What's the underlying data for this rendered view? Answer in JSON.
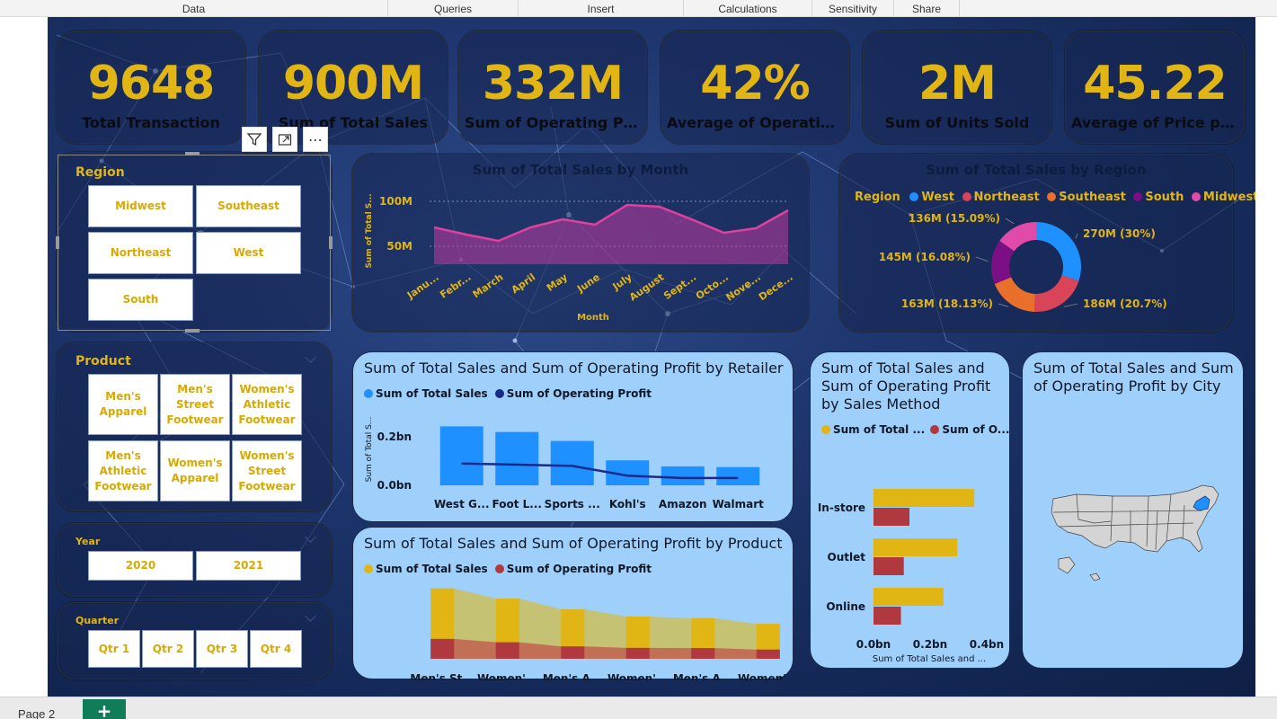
{
  "ribbon": {
    "tabs": [
      "Data",
      "Queries",
      "Insert",
      "Calculations",
      "Sensitivity",
      "Share"
    ]
  },
  "kpis": [
    {
      "value": "9648",
      "label": "Total Transaction"
    },
    {
      "value": "900M",
      "label": "Sum of Total Sales"
    },
    {
      "value": "332M",
      "label": "Sum of Operating Pr..."
    },
    {
      "value": "42%",
      "label": "Average of Operating..."
    },
    {
      "value": "2M",
      "label": "Sum of Units Sold"
    },
    {
      "value": "45.22",
      "label": "Average of Price per..."
    }
  ],
  "slicers": {
    "region": {
      "title": "Region",
      "options": [
        "Midwest",
        "Southeast",
        "Northeast",
        "West",
        "South"
      ]
    },
    "product": {
      "title": "Product",
      "options": [
        "Men's Apparel",
        "Men's Street Footwear",
        "Women's Athletic Footwear",
        "Men's Athletic Footwear",
        "Women's Apparel",
        "Women's Street Footwear"
      ]
    },
    "year": {
      "title": "Year",
      "options": [
        "2020",
        "2021"
      ]
    },
    "quarter": {
      "title": "Quarter",
      "options": [
        "Qtr 1",
        "Qtr 2",
        "Qtr 3",
        "Qtr 4"
      ]
    }
  },
  "colors": {
    "accent_yellow": "#e1b514",
    "card_light": "#9fd0fb",
    "bar_blue": "#1e90ff",
    "line_navy": "#1a2a8a",
    "area_magenta": "#e040a0",
    "bar_red": "#b0393f",
    "pie_west": "#1e90ff",
    "pie_northeast": "#d94458",
    "pie_southeast": "#e8702a",
    "pie_south": "#7a0f86",
    "pie_midwest": "#e04aa8",
    "map_highlight": "#1e90ff",
    "add_page": "#117d58"
  },
  "icons": {
    "filter": "filter-icon",
    "focus": "focus-mode-icon",
    "more": "more-options-icon"
  },
  "page": {
    "tab_label": "Page 2",
    "add_label": "+"
  },
  "chart_data": [
    {
      "type": "area",
      "title": "Sum of Total Sales by Month",
      "xlabel": "Month",
      "ylabel": "Sum of Total S...",
      "categories": [
        "Janu...",
        "Febr...",
        "March",
        "April",
        "May",
        "June",
        "July",
        "August",
        "Sept...",
        "Octo...",
        "Nove...",
        "Dece..."
      ],
      "values": [
        71,
        63,
        56,
        71,
        80,
        74,
        96,
        94,
        80,
        65,
        70,
        90
      ],
      "y_units": "M",
      "yticks": [
        "100M",
        "50M"
      ],
      "ylim": [
        30,
        110
      ]
    },
    {
      "type": "pie",
      "title": "Sum of Total Sales by Region",
      "legend_title": "Region",
      "slices": [
        {
          "name": "West",
          "value": 270,
          "label": "270M (30%)"
        },
        {
          "name": "Northeast",
          "value": 186,
          "label": "186M (20.7%)"
        },
        {
          "name": "Southeast",
          "value": 163,
          "label": "163M (18.13%)"
        },
        {
          "name": "South",
          "value": 145,
          "label": "145M (16.08%)"
        },
        {
          "name": "Midwest",
          "value": 136,
          "label": "136M (15.09%)"
        }
      ]
    },
    {
      "type": "bar",
      "title": "Sum of Total Sales and Sum of Operating Profit by Retailer",
      "ylabel": "Sum of Total S...",
      "categories": [
        "West G...",
        "Foot L...",
        "Sports ...",
        "Kohl's",
        "Amazon",
        "Walmart"
      ],
      "series": [
        {
          "name": "Sum of Total Sales",
          "values": [
            0.243,
            0.22,
            0.183,
            0.103,
            0.078,
            0.075
          ]
        },
        {
          "name": "Sum of Operating Profit",
          "values": [
            0.09,
            0.085,
            0.08,
            0.04,
            0.03,
            0.03
          ]
        }
      ],
      "yticks": [
        "0.2bn",
        "0.0bn"
      ],
      "ylim": [
        0,
        0.3
      ]
    },
    {
      "type": "area",
      "title": "Sum of Total Sales and Sum of Operating Profit by Product",
      "categories": [
        "Men's St...",
        "Women'...",
        "Men's A...",
        "Women'...",
        "Men's A...",
        "Women'..."
      ],
      "series": [
        {
          "name": "Sum of Total Sales",
          "values": [
            208,
            180,
            153,
            129,
            123,
            106
          ]
        },
        {
          "name": "Sum of Operating Profit",
          "values": [
            82,
            68,
            51,
            45,
            44,
            38
          ]
        }
      ]
    },
    {
      "type": "bar",
      "title": "Sum of Total Sales and Sum of Operating Profit by Sales Method",
      "xlabel": "Sum of Total Sales and ...",
      "categories": [
        "In-store",
        "Outlet",
        "Online"
      ],
      "series": [
        {
          "name": "Sum of Total ...",
          "values": [
            0.356,
            0.296,
            0.247
          ]
        },
        {
          "name": "Sum of O...",
          "values": [
            0.127,
            0.107,
            0.097
          ]
        }
      ],
      "xticks": [
        "0.0bn",
        "0.2bn",
        "0.4bn"
      ],
      "xlim": [
        0,
        0.4
      ]
    }
  ],
  "map": {
    "title": "Sum of Total Sales and Sum of Operating Profit by City",
    "highlight": "New York"
  }
}
